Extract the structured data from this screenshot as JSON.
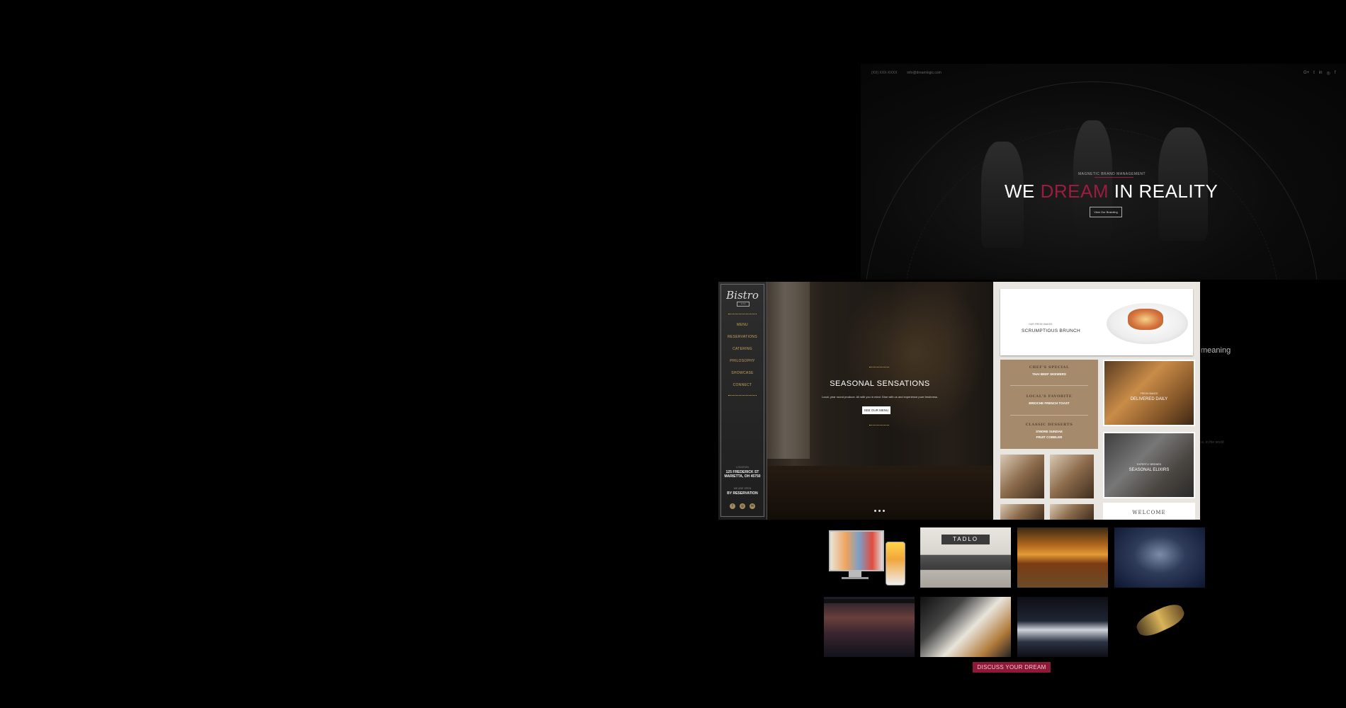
{
  "hero": {
    "phone": "(XX) XXX-XXXX",
    "email": "info@dreamlogic.com",
    "social": [
      "G+",
      "t",
      "in",
      "◎",
      "f"
    ],
    "tagline": "MAGNETIC BRAND MANAGEMENT",
    "headline_pre": "WE ",
    "headline_accent": "DREAM",
    "headline_post": " IN REALITY",
    "button": "View Our Branding",
    "accent_color": "#9b1c40"
  },
  "side_text": {
    "meaning": "meaning",
    "faded_right": "ious, in the world",
    "faded_left": ""
  },
  "bistro": {
    "logo": "Bistro",
    "logo_sub": "1 2 3",
    "menu": [
      "MENU",
      "RESERVATIONS",
      "CATERING",
      "PHILOSOPHY",
      "SHOWCASE",
      "CONNECT"
    ],
    "location_label": "LOCATION",
    "address_line1": "125 FREDERICK ST",
    "address_line2": "MARIETTA, OH 45750",
    "hours_label": "WE ARE OPEN",
    "hours": "BY RESERVATION",
    "social_icons": [
      "f",
      "◎",
      "✉"
    ],
    "hero_title": "SEASONAL SENSATIONS",
    "hero_sub": "Local, year round produce. All with you in mind. Dine with us and experience pure freshness.",
    "hero_button": "SEE OUR MENU",
    "gold_color": "#c9a55a"
  },
  "menu_panel": {
    "brunch_small": "OUR FRESH BAKED",
    "brunch_title": "SCRUMPTIOUS BRUNCH",
    "specials": [
      {
        "heading": "CHEF'S SPECIAL",
        "item": "THAI BEEF SKEWERS",
        "note": "with Hand Cut Potatoes"
      },
      {
        "heading": "LOCAL'S FAVORITE",
        "item": "BRIOCHE FRENCH TOAST",
        "note": "with seasonal fruit"
      },
      {
        "heading": "CLASSIC DESSERTS",
        "item": "S'MORE SUNDAE",
        "item2": "FRUIT COBBLER"
      }
    ],
    "bread_small": "FRESH BAKED",
    "bread_title": "DELIVERED DAILY",
    "elixir_small": "EXPERTLY BREWED",
    "elixir_title": "SEASONAL ELIXIRS",
    "welcome": "WELCOME"
  },
  "portfolio": {
    "tadlo_sign": "TADLO",
    "cta": "DISCUSS YOUR DREAM",
    "cta_color": "#8e1838"
  }
}
